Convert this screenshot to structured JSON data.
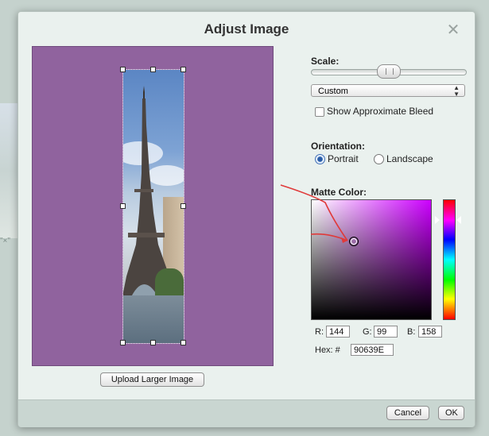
{
  "dialog": {
    "title": "Adjust Image",
    "close_icon": "close-icon"
  },
  "background_page": {
    "snippet": "\"×\""
  },
  "preview": {
    "canvas_color": "#90639e",
    "upload_button": "Upload Larger Image"
  },
  "scale": {
    "label": "Scale:",
    "preset": "Custom",
    "show_bleed_label": "Show Approximate Bleed",
    "show_bleed_checked": false
  },
  "orientation": {
    "label": "Orientation:",
    "options": [
      "Portrait",
      "Landscape"
    ],
    "selected": "Portrait"
  },
  "matte": {
    "label": "Matte Color:",
    "r_label": "R:",
    "r": "144",
    "g_label": "G:",
    "g": "99",
    "b_label": "B:",
    "b": "158",
    "hex_label": "Hex: #",
    "hex": "90639E"
  },
  "footer": {
    "cancel": "Cancel",
    "ok": "OK"
  }
}
